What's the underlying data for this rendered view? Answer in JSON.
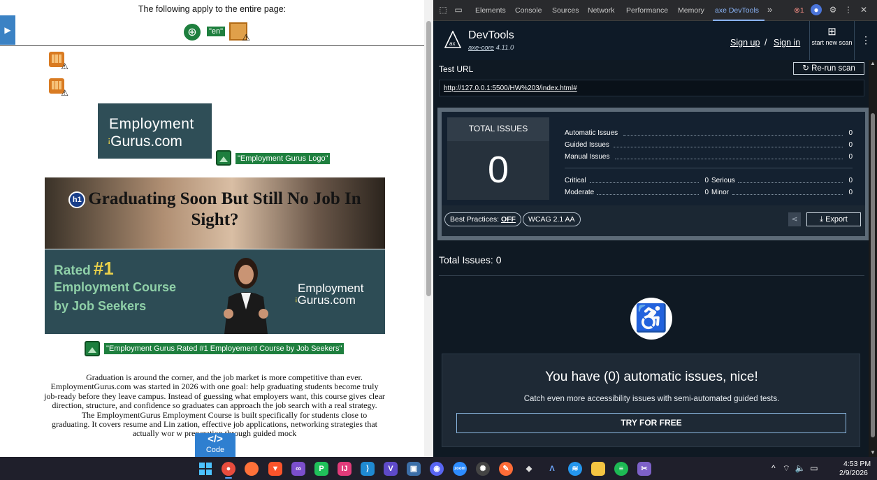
{
  "page": {
    "applies_text": "The following apply to the entire page:",
    "lang_badge": "\"en\"",
    "logo": {
      "line1": "Employment",
      "line2": "Gurus.com"
    },
    "logo_alt": "\"Employment Gurus Logo\"",
    "h1_badge": "h1",
    "hero_title": "Graduating Soon But Still No Job In Sight?",
    "banner": {
      "rated": "Rated",
      "number": "#1",
      "line2": "Employment Course",
      "line3": "by Job Seekers",
      "logo1": "Employment",
      "logo2": "Gurus.com"
    },
    "banner_alt": "\"Employment Gurus Rated #1 Employement Course by Job Seekers\"",
    "paragraph1": "Graduation is around the corner, and the job market is more competitive than ever. EmploymentGurus.com was started in 2026 with one goal: help graduating students become truly job-ready before they leave campus. Instead of guessing what employers want, this course gives clear direction, structure, and confidence so graduates can approach the job search with a real strategy.",
    "paragraph2": "The EmploymentGurus Employment Course is built specifically for students close to graduating. It covers resume and Lin         zation, effective job applications, networking strategies that actually wor         w preparation through guided mock",
    "code_chip": {
      "symbol": "</>",
      "label": "Code"
    }
  },
  "devtools": {
    "tabs": [
      "Elements",
      "Console",
      "Sources",
      "Network",
      "Performance",
      "Memory",
      "axe DevTools"
    ],
    "more": "»",
    "error_count": "1",
    "axe": {
      "name": "DevTools",
      "version_prefix": "axe-core",
      "version": "4.11.0",
      "sign_up": "Sign up",
      "slash": "/",
      "sign_in": "Sign in",
      "new_scan": "start new scan",
      "test_url_label": "Test URL",
      "rerun": "Re-run scan",
      "url": "http://127.0.0.1:5500/HW%203/index.html#",
      "total_issues_label": "TOTAL ISSUES",
      "total_issues": "0",
      "rows": [
        {
          "label": "Automatic Issues",
          "value": "0"
        },
        {
          "label": "Guided Issues",
          "value": "0"
        },
        {
          "label": "Manual Issues",
          "value": "0"
        }
      ],
      "severity": [
        {
          "label": "Critical",
          "value": "0"
        },
        {
          "label": "Serious",
          "value": "0"
        },
        {
          "label": "Moderate",
          "value": "0"
        },
        {
          "label": "Minor",
          "value": "0"
        }
      ],
      "best_practices_label": "Best Practices:",
      "best_practices_value": "OFF",
      "standard": "WCAG 2.1 AA",
      "export": "Export",
      "total_issues_heading": "Total Issues: 0",
      "nice_title": "You have (0) automatic issues, nice!",
      "nice_sub": "Catch even more accessibility issues with semi-automated guided tests.",
      "try_btn": "TRY FOR FREE"
    }
  },
  "taskbar": {
    "time": "4:53 PM",
    "date": "2/9/2026",
    "apps": [
      "start-icon",
      "chrome-icon",
      "firefox-icon",
      "brave-icon",
      "visual-studio-icon",
      "pycharm-icon",
      "intellij-icon",
      "vscode-icon",
      "vs-installer-icon",
      "terminal-icon",
      "discord-icon",
      "zoom-icon",
      "chatgpt-icon",
      "postman-icon",
      "unity-icon",
      "arc-icon",
      "docker-icon",
      "file-explorer-icon",
      "spotify-icon",
      "snipping-tool-icon"
    ]
  },
  "colors": {
    "devtools_bg": "#202124",
    "axe_panel_bg": "#0f1923",
    "accent_blue": "#8ab4f8",
    "logo_teal": "#2f4e57",
    "alt_green": "#1e7f3e"
  }
}
